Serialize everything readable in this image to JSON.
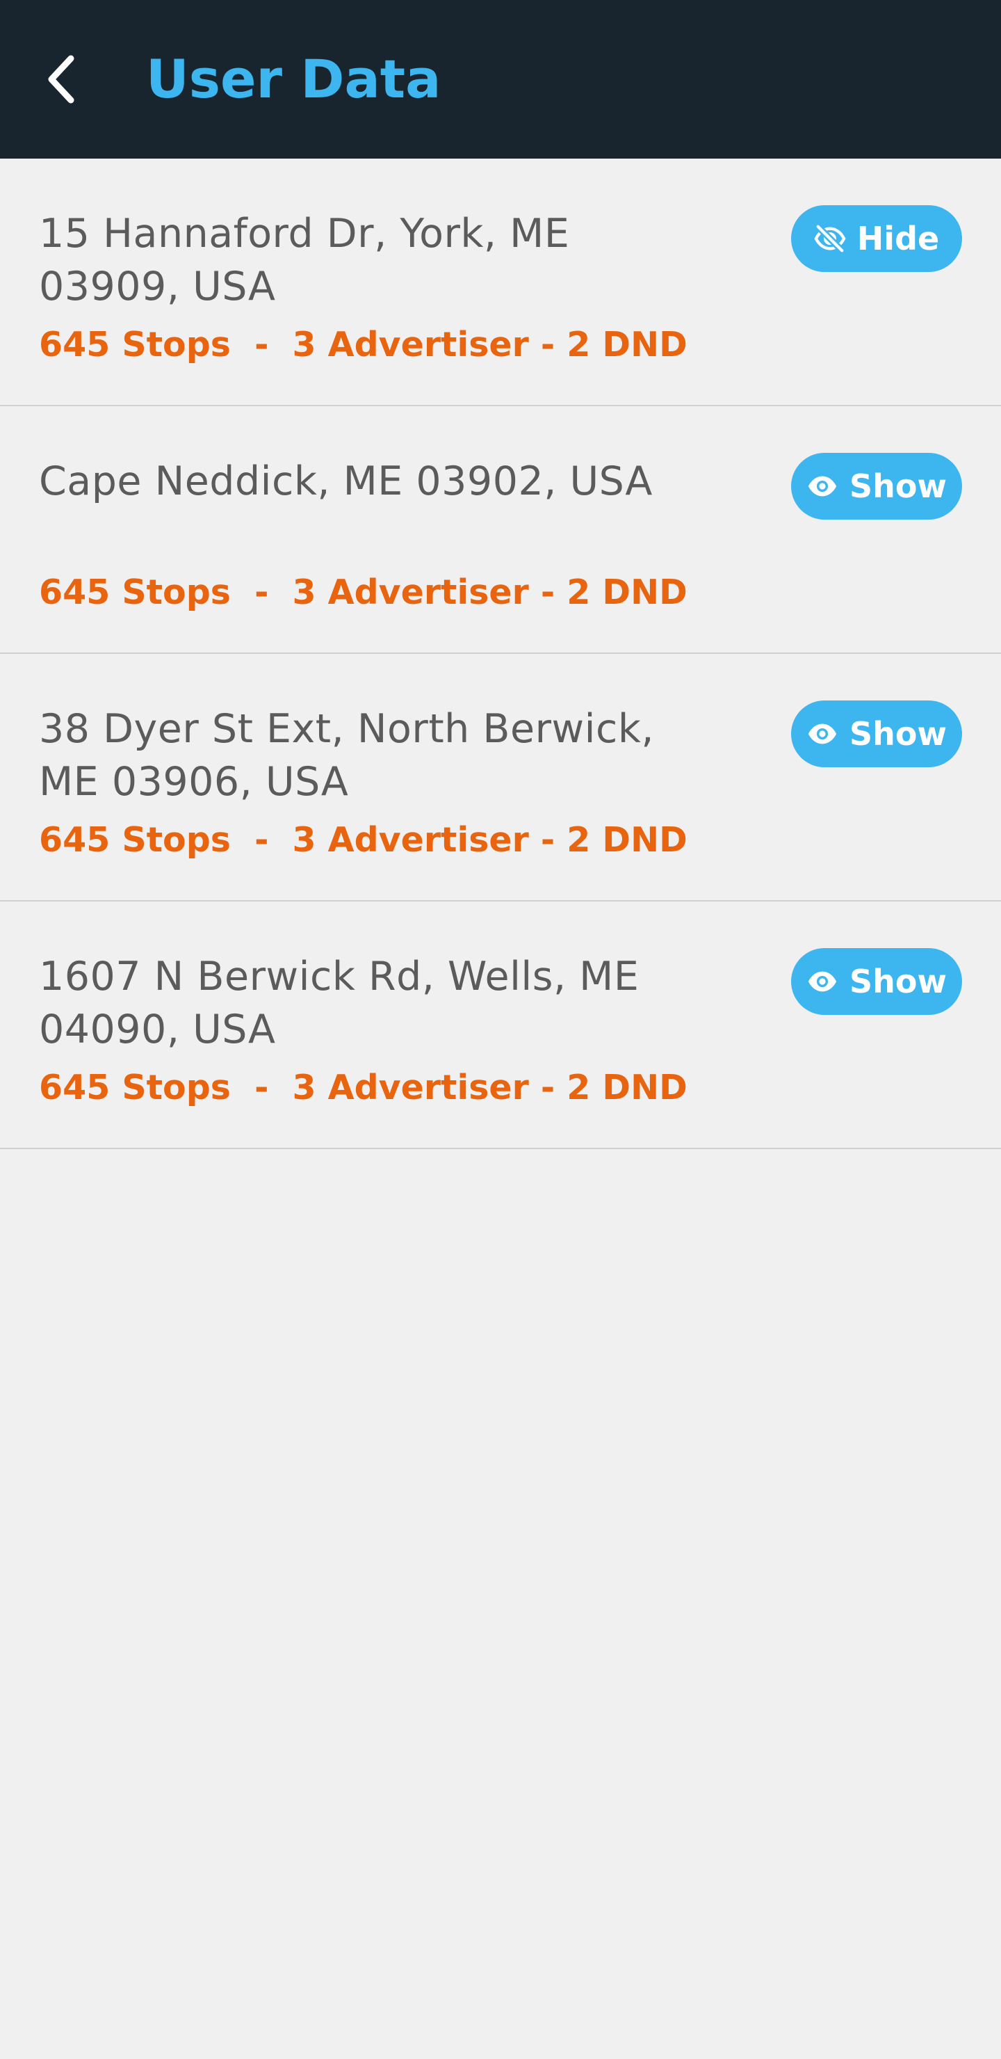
{
  "header": {
    "title": "User Data",
    "back_icon": "chevron-left-icon"
  },
  "colors": {
    "header_bg": "#19252e",
    "accent": "#3db6f0",
    "stats": "#e8640f",
    "address": "#5b5b5b",
    "background": "#f0f0f0"
  },
  "items": [
    {
      "address": "15 Hannaford Dr, York, ME 03909, USA",
      "stats": "645 Stops  -  3 Advertiser - 2 DND",
      "button_label": "Hide",
      "button_icon": "eye-off-icon"
    },
    {
      "address": "Cape Neddick, ME 03902, USA",
      "stats": "645 Stops  -  3 Advertiser - 2 DND",
      "button_label": "Show",
      "button_icon": "eye-icon"
    },
    {
      "address": "38 Dyer St Ext, North Berwick, ME 03906, USA",
      "stats": "645 Stops  -  3 Advertiser - 2 DND",
      "button_label": "Show",
      "button_icon": "eye-icon"
    },
    {
      "address": "1607 N Berwick Rd, Wells, ME 04090, USA",
      "stats": "645 Stops  -  3 Advertiser - 2 DND",
      "button_label": "Show",
      "button_icon": "eye-icon"
    }
  ]
}
